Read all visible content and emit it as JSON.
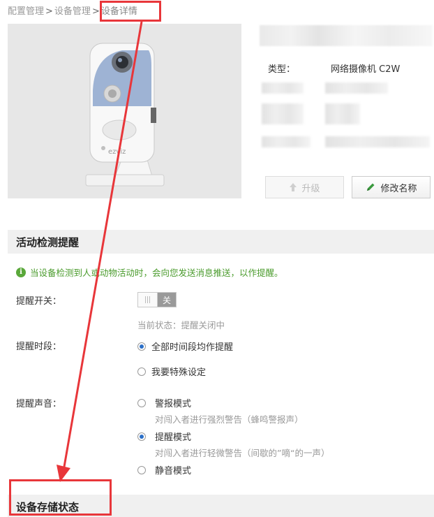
{
  "breadcrumb": {
    "item1": "配置管理",
    "item2": "设备管理",
    "current": "设备详情",
    "separator": ">"
  },
  "device": {
    "type_label": "类型：",
    "type_value": "网络摄像机 C2W",
    "camera_brand_text": "ezviz"
  },
  "actions": {
    "upgrade": "升级",
    "rename": "修改名称"
  },
  "motion_section": {
    "title": "活动检测提醒",
    "notice": "当设备检测到人或动物活动时，会向您发送消息推送，以作提醒。",
    "notice_icon_glyph": "i",
    "switch_label": "提醒开关：",
    "switch_state_text": "关",
    "current_status": "当前状态：提醒关闭中",
    "period_label": "提醒时段：",
    "period_options": [
      {
        "label": "全部时间段均作提醒",
        "checked": true
      },
      {
        "label": "我要特殊设定",
        "checked": false
      }
    ],
    "sound_label": "提醒声音：",
    "sound_options": [
      {
        "label": "警报模式",
        "desc": "对闯入者进行强烈警告（蜂鸣警报声）",
        "checked": false
      },
      {
        "label": "提醒模式",
        "desc": "对闯入者进行轻微警告（间歇的”嘀“的一声）",
        "checked": true
      },
      {
        "label": "静音模式",
        "desc": "",
        "checked": false
      }
    ]
  },
  "storage_section": {
    "title": "设备存储状态"
  },
  "colors": {
    "annotation_red": "#e8363a",
    "notice_green": "#4a9b2c",
    "radio_blue": "#2b6fc7",
    "section_bg": "#f0f0f0"
  }
}
